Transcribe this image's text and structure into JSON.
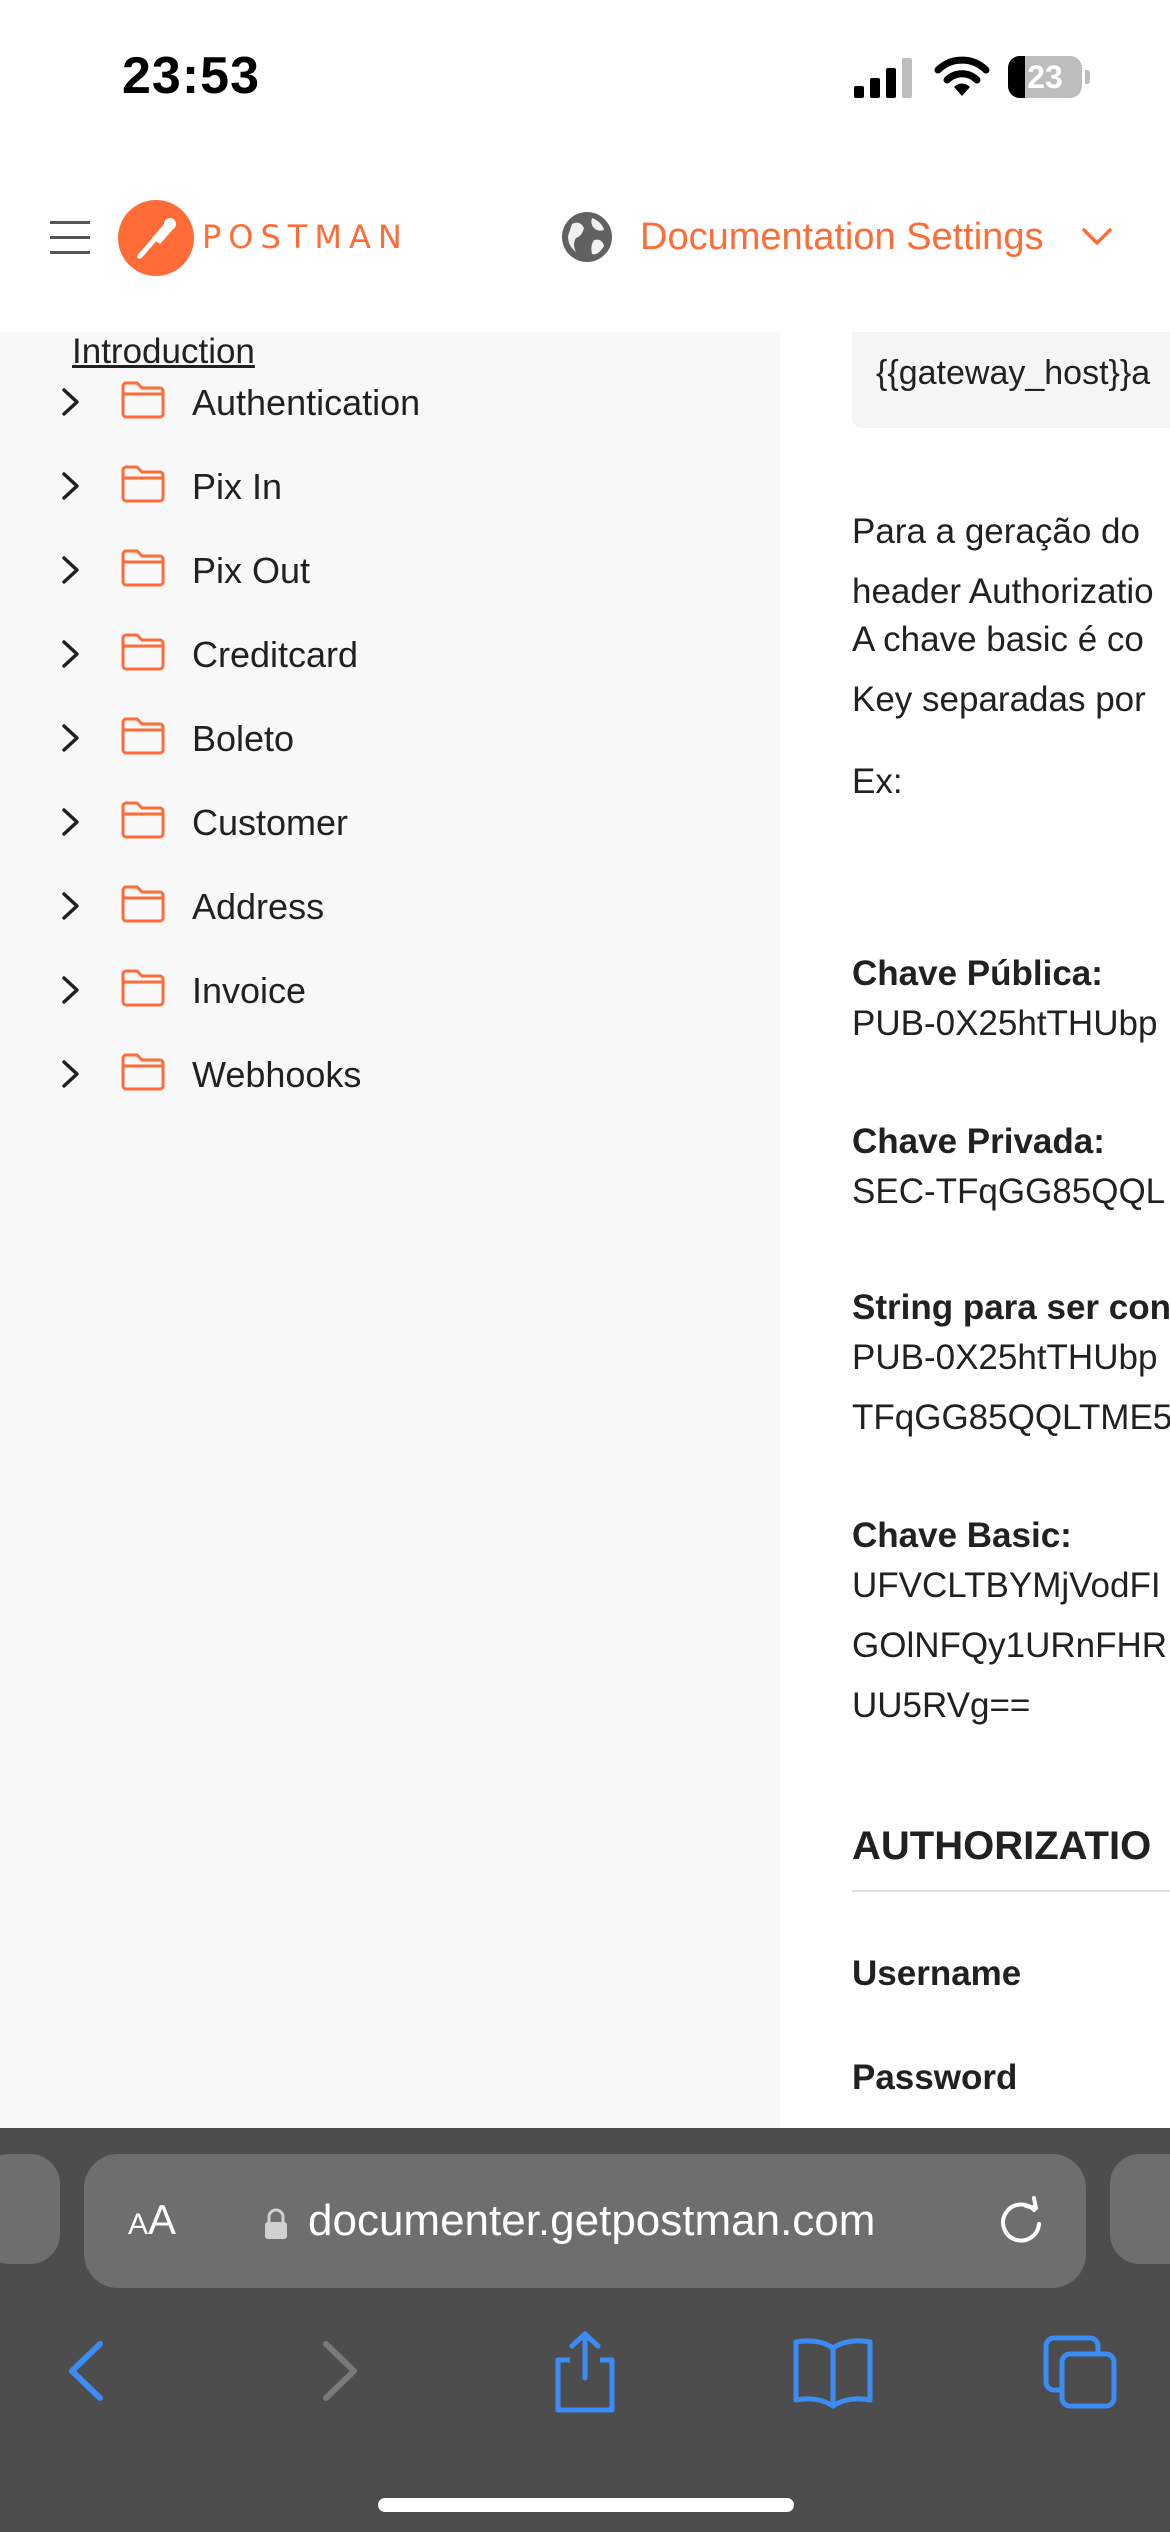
{
  "status_bar": {
    "time": "23:53",
    "battery_level": "23",
    "battery_fraction": 0.23
  },
  "header": {
    "logo_text": "POSTMAN",
    "doc_settings_label": "Documentation Settings",
    "accent_color": "#FF6C37"
  },
  "sidebar": {
    "intro_link": "Introduction",
    "items": [
      {
        "label": "Authentication",
        "icon": "folder-icon"
      },
      {
        "label": "Pix In",
        "icon": "folder-icon"
      },
      {
        "label": "Pix Out",
        "icon": "folder-icon"
      },
      {
        "label": "Creditcard",
        "icon": "folder-icon"
      },
      {
        "label": "Boleto",
        "icon": "folder-icon"
      },
      {
        "label": "Customer",
        "icon": "folder-icon"
      },
      {
        "label": "Address",
        "icon": "folder-icon"
      },
      {
        "label": "Invoice",
        "icon": "folder-icon"
      },
      {
        "label": "Webhooks",
        "icon": "folder-icon"
      }
    ]
  },
  "content": {
    "code_snippet": "{{gateway_host}}a",
    "para1_line1": "Para a geração do",
    "para1_line2": "header Authorizatio",
    "para2_line1": "A chave basic é co",
    "para2_line2": "Key separadas por",
    "example_label": "Ex:",
    "public_key_label": "Chave Pública:",
    "public_key_value": "PUB-0X25htTHUbp",
    "private_key_label": "Chave Privada:",
    "private_key_value": "SEC-TFqGG85QQL",
    "string_label": "String para ser con",
    "string_line1": "PUB-0X25htTHUbp",
    "string_line2": "TFqGG85QQLTME5",
    "basic_key_label": "Chave Basic:",
    "basic_line1": "UFVCLTBYMjVodFI",
    "basic_line2": "GOlNFQy1URnFHR",
    "basic_line3": "UU5RVg==",
    "auth_heading": "AUTHORIZATIO",
    "username_label": "Username",
    "password_label": "Password"
  },
  "browser": {
    "aa_small": "A",
    "aa_big": "A",
    "url": "documenter.getpostman.com",
    "toolbar_color": "#4d4d4d",
    "link_color": "#3b8df5"
  }
}
